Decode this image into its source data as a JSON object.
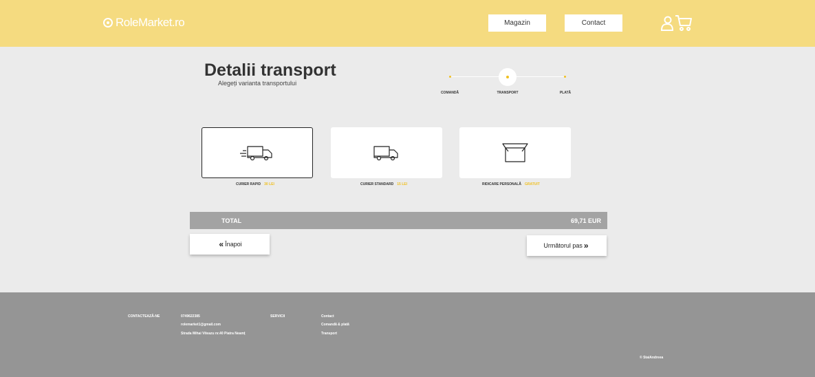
{
  "header": {
    "logo_text": "RoleMarket.ro",
    "nav": {
      "magazin": "Magazin",
      "contact": "Contact"
    },
    "icons": [
      "user-icon",
      "cart-icon"
    ]
  },
  "page": {
    "title": "Detalii transport",
    "subtitle": "Alegeți varianta transportului"
  },
  "stepper": {
    "steps": [
      "COMANDĂ",
      "TRANSPORT",
      "PLATĂ"
    ],
    "active_step": "TRANSPORT"
  },
  "transport_options": [
    {
      "label": "CURIER RAPID",
      "price": "30 LEI",
      "icon": "fast-truck-icon",
      "selected": true
    },
    {
      "label": "CURIER STANDARD",
      "price": "15 LEI",
      "icon": "truck-icon",
      "selected": false
    },
    {
      "label": "RIDICARE PERSONALĂ",
      "price": "GRATUIT",
      "icon": "box-icon",
      "selected": false
    }
  ],
  "total": {
    "label": "TOTAL",
    "value": "69,71 EUR"
  },
  "buttons": {
    "back": "Înapoi",
    "next": "Următorul pas"
  },
  "footer": {
    "contact_heading": "CONTACTEAZĂ-NE",
    "phone": "0749622385",
    "email": "rolemarket1@gmail.com",
    "address": "Strada Mihai Viteazu nr.40 Piatra Neamț",
    "services_heading": "SERVICII",
    "services": [
      "Contact",
      "Comandă & plată",
      "Transport"
    ],
    "copyright": "© StaiAndreea"
  },
  "colors": {
    "header_bg": "#f5db80",
    "accent": "#f0c020",
    "footer_bg": "#959595",
    "total_bg": "#a3a3a3"
  }
}
